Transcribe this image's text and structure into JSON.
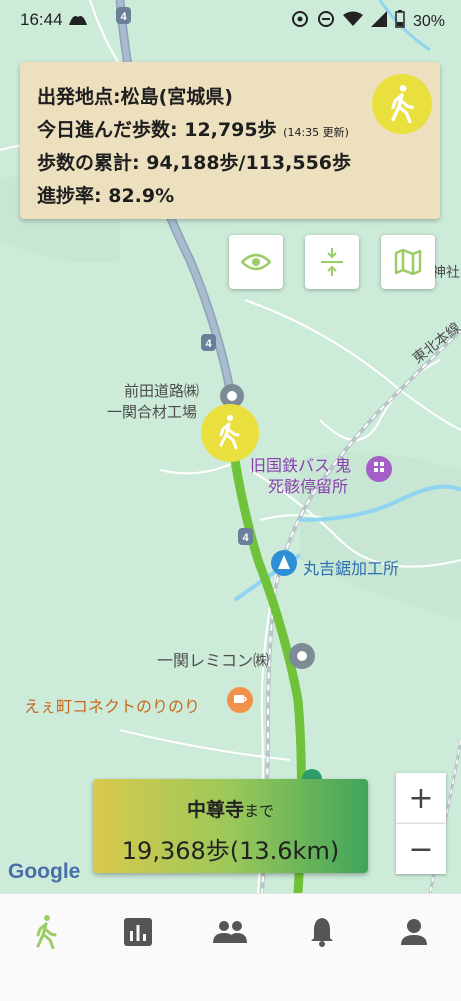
{
  "status_bar": {
    "time": "16:44",
    "battery": "30%"
  },
  "info_card": {
    "origin_label": "出発地点:",
    "origin_value": "松島(宮城県)",
    "today_steps_label": "今日進んだ歩数: ",
    "today_steps_value": "12,795歩",
    "today_updated": "(14:35 更新)",
    "total_steps_label": "歩数の累計: ",
    "total_steps_value": "94,188歩/113,556歩",
    "progress_label": "進捗率: ",
    "progress_value": "82.9%"
  },
  "map_labels": {
    "road_number": "4",
    "maeda": "前田道路㈱",
    "ichinoseki_gouzai": "一関合材工場",
    "kokutetsu_bus_1": "旧国鉄バス 鬼",
    "kokutetsu_bus_2": "死骸停留所",
    "maruyoshi": "丸吉鋸加工所",
    "remicon": "一関レミコン㈱",
    "connect": "えぇ町コネクトのりのり",
    "tohoku_line": "東北本線",
    "shrine": "神社"
  },
  "destination": {
    "name": "中尊寺",
    "suffix": "まで",
    "remaining": "19,368歩(13.6km)"
  },
  "zoom": {
    "in": "+",
    "out": "−"
  },
  "google_logo": "Google",
  "colors": {
    "map_bg": "#cdebd9",
    "route": "#6fc23a",
    "walk_yellow": "#e9df3f",
    "card_bg": "#ede0bf",
    "nav_active": "#9ccc65"
  }
}
